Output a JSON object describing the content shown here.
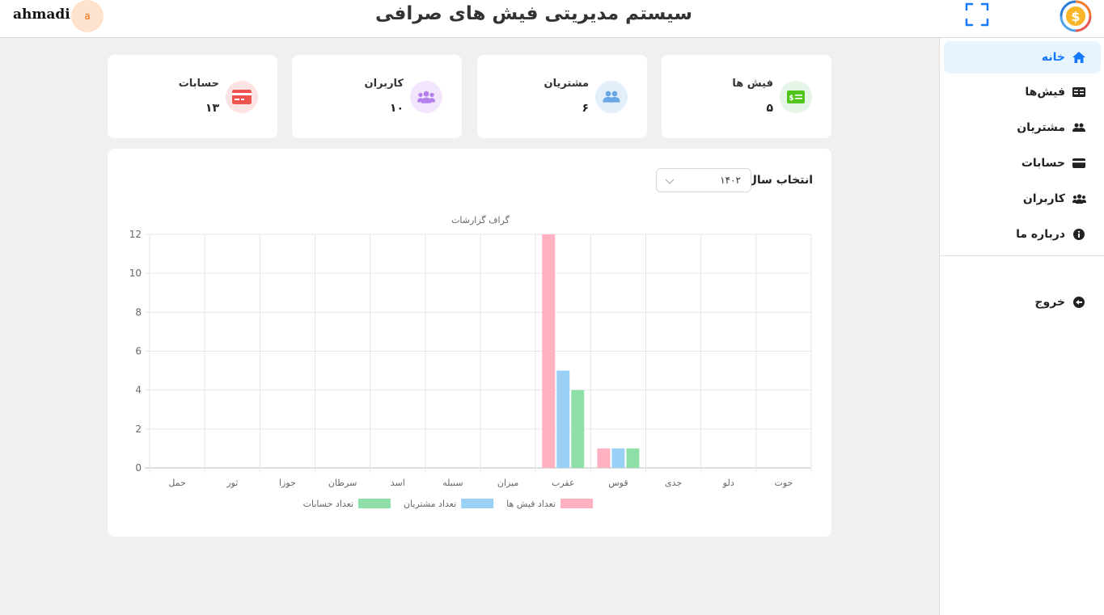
{
  "header": {
    "username": "ahmadi",
    "avatar_letter": "a",
    "title": "سیستم مدیریتی فیش های صرافی",
    "fullscreen_icon": "fullscreen-icon",
    "logo_icon": "dollar-coin-icon"
  },
  "sidebar": {
    "items": [
      {
        "label": "خانه",
        "icon": "home-icon",
        "active": true
      },
      {
        "label": "فیش‌ها",
        "icon": "receipt-icon",
        "active": false
      },
      {
        "label": "مشتریان",
        "icon": "customers-icon",
        "active": false
      },
      {
        "label": "حسابات",
        "icon": "credit-card-icon",
        "active": false
      },
      {
        "label": "کاربران",
        "icon": "users-icon",
        "active": false
      },
      {
        "label": "درباره ما",
        "icon": "info-icon",
        "active": false
      }
    ],
    "logout": {
      "label": "خروج",
      "icon": "logout-icon"
    }
  },
  "stats": [
    {
      "label": "فیش ها",
      "value": "۵",
      "icon": "receipt-icon",
      "color": "#52c41a",
      "bg": "#e3f6e8"
    },
    {
      "label": "مشتریان",
      "value": "۶",
      "icon": "customers-icon",
      "color": "#69a7e6",
      "bg": "#e3eefb"
    },
    {
      "label": "کاربران",
      "value": "۱۰",
      "icon": "users-icon",
      "color": "#b37feb",
      "bg": "#f2e6fd"
    },
    {
      "label": "حسابات",
      "value": "۱۳",
      "icon": "credit-card-icon",
      "color": "#ef5350",
      "bg": "#fde3e3"
    }
  ],
  "year_filter": {
    "label": "انتخاب سال",
    "value": "۱۴۰۲"
  },
  "chart_data": {
    "type": "bar",
    "title": "گراف گزارشات",
    "categories": [
      "حمل",
      "ثور",
      "جوزا",
      "سرطان",
      "اسد",
      "سنبله",
      "میزان",
      "عقرب",
      "قوس",
      "جدی",
      "دلو",
      "حوت"
    ],
    "series": [
      {
        "name": "تعداد فیش ها",
        "color": "#ffb1c1",
        "values": [
          0,
          0,
          0,
          0,
          0,
          0,
          0,
          12,
          1,
          0,
          0,
          0
        ]
      },
      {
        "name": "تعداد مشتریان",
        "color": "#9ad0f5",
        "values": [
          0,
          0,
          0,
          0,
          0,
          0,
          0,
          5,
          1,
          0,
          0,
          0
        ]
      },
      {
        "name": "تعداد حسابات",
        "color": "#8fe0a8",
        "values": [
          0,
          0,
          0,
          0,
          0,
          0,
          0,
          4,
          1,
          0,
          0,
          0
        ]
      }
    ],
    "ylim": [
      0,
      12
    ],
    "yticks": [
      0,
      2,
      4,
      6,
      8,
      10,
      12
    ],
    "grid": true,
    "legend": "bottom"
  }
}
